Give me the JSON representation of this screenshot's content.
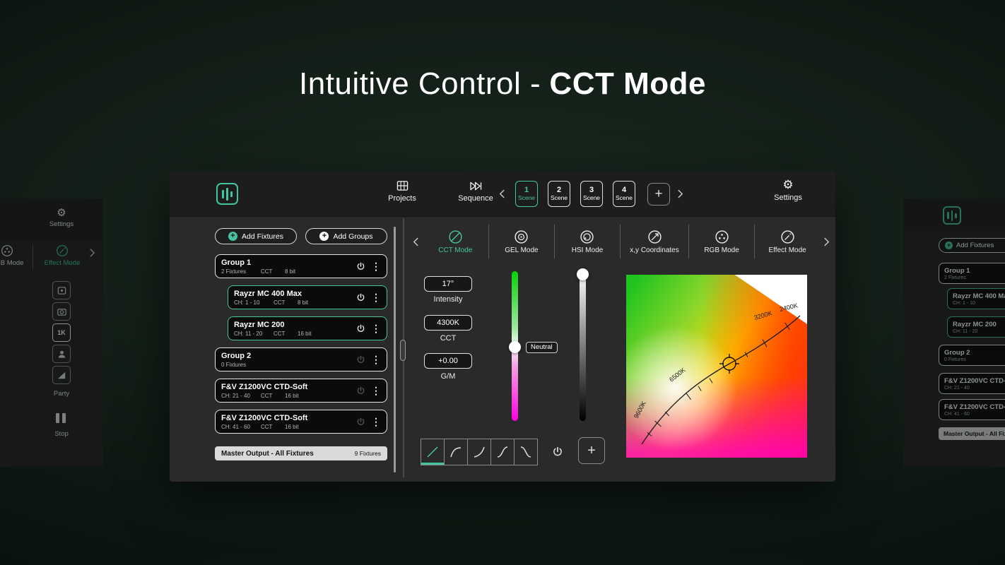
{
  "hero": {
    "title_light": "Intuitive Control -",
    "title_bold": "CCT Mode"
  },
  "colors": {
    "accent": "#45C4A1"
  },
  "topbar": {
    "projects": "Projects",
    "sequence": "Sequence",
    "settings": "Settings",
    "scenes": [
      {
        "number": "1",
        "label": "Scene"
      },
      {
        "number": "2",
        "label": "Scene"
      },
      {
        "number": "3",
        "label": "Scene"
      },
      {
        "number": "4",
        "label": "Scene"
      }
    ],
    "add_scene": "+"
  },
  "fixtures": {
    "add_fixtures": "Add Fixtures",
    "add_groups": "Add Groups",
    "items": [
      {
        "title": "Group 1",
        "sub": [
          "2 Fixtures",
          "CCT",
          "8 bit"
        ]
      },
      {
        "title": "Rayzr MC 400 Max",
        "sub": [
          "CH: 1 - 10",
          "CCT",
          "8 bit"
        ]
      },
      {
        "title": "Rayzr MC 200",
        "sub": [
          "CH: 11 - 20",
          "CCT",
          "16 bit"
        ]
      },
      {
        "title": "Group 2",
        "sub": [
          "0 Fixtures",
          "",
          ""
        ]
      },
      {
        "title": "F&V Z1200VC CTD-Soft",
        "sub": [
          "CH: 21 - 40",
          "CCT",
          "16 bit"
        ]
      },
      {
        "title": "F&V Z1200VC CTD-Soft",
        "sub": [
          "CH: 41 - 60",
          "CCT",
          "16 bit"
        ]
      }
    ],
    "master": {
      "title": "Master Output - All Fixtures",
      "count": "9 Fixtures"
    }
  },
  "modes": {
    "tabs": [
      {
        "label": "CCT Mode"
      },
      {
        "label": "GEL Mode"
      },
      {
        "label": "HSI Mode"
      },
      {
        "label": "x,y Coordinates"
      },
      {
        "label": "RGB Mode"
      },
      {
        "label": "Effect Mode"
      }
    ]
  },
  "controls": {
    "intensity": {
      "value": "17°",
      "label": "Intensity"
    },
    "cct": {
      "value": "4300K",
      "label": "CCT"
    },
    "gm": {
      "value": "+0.00",
      "label": "G/M"
    },
    "slider_tag": "Neutral",
    "add_button": "+"
  },
  "gamut": {
    "k9600": "9600K",
    "k6500": "6500K",
    "k3200": "3200K",
    "k2400": "2400K"
  },
  "left_fragment": {
    "settings": "Settings",
    "party": "Party",
    "stop": "Stop",
    "preset_1k": "1K"
  }
}
